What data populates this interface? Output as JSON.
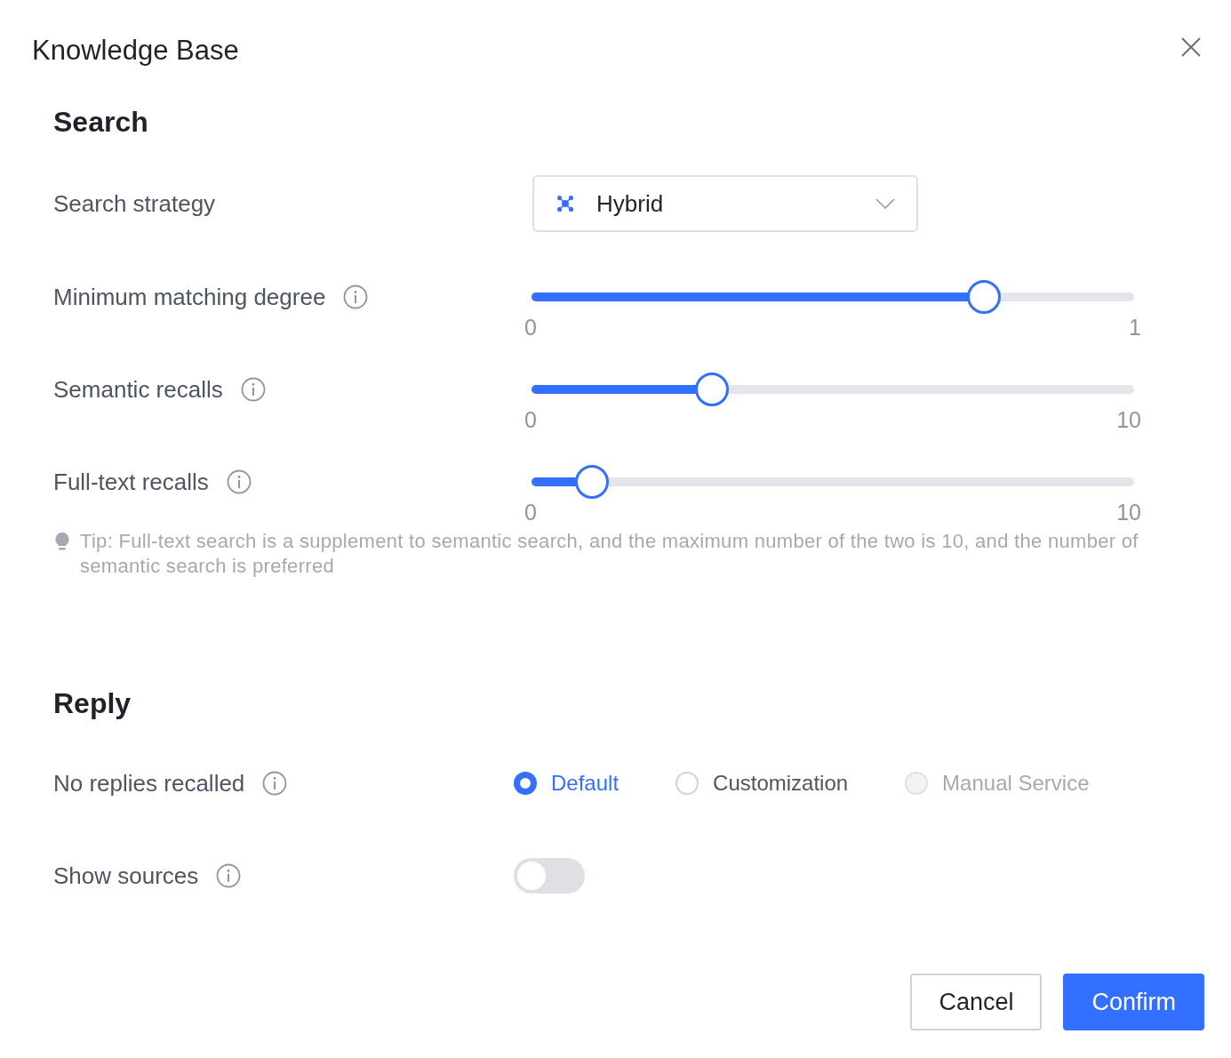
{
  "dialog": {
    "title": "Knowledge Base"
  },
  "sections": [
    {
      "heading": "Search",
      "rows": [
        {
          "kind": "select",
          "label": "Search strategy",
          "info": false,
          "value": "Hybrid"
        },
        {
          "kind": "slider",
          "label": "Minimum matching degree",
          "info": true,
          "level": 0.75,
          "min": "0",
          "max": "1"
        },
        {
          "kind": "slider",
          "label": "Semantic recalls",
          "info": true,
          "level": 0.3,
          "min": "0",
          "max": "10"
        },
        {
          "kind": "slider",
          "label": "Full-text recalls",
          "info": true,
          "level": 0.1,
          "min": "0",
          "max": "10"
        },
        {
          "kind": "tip",
          "text": "Tip: Full-text search is a supplement to semantic search, and the maximum number of the two is 10, and the number of semantic search is preferred"
        }
      ]
    },
    {
      "heading": "Reply",
      "rows": [
        {
          "kind": "radio",
          "label": "No replies recalled",
          "info": true,
          "options": [
            {
              "label": "Default",
              "selected": true,
              "disabled": false
            },
            {
              "label": "Customization",
              "selected": false,
              "disabled": false
            },
            {
              "label": "Manual Service",
              "selected": false,
              "disabled": true
            }
          ]
        },
        {
          "kind": "switch",
          "label": "Show sources",
          "info": true,
          "on": false
        }
      ]
    }
  ],
  "buttons": [
    {
      "label": "Cancel",
      "primary": false
    },
    {
      "label": "Confirm",
      "primary": true
    }
  ]
}
